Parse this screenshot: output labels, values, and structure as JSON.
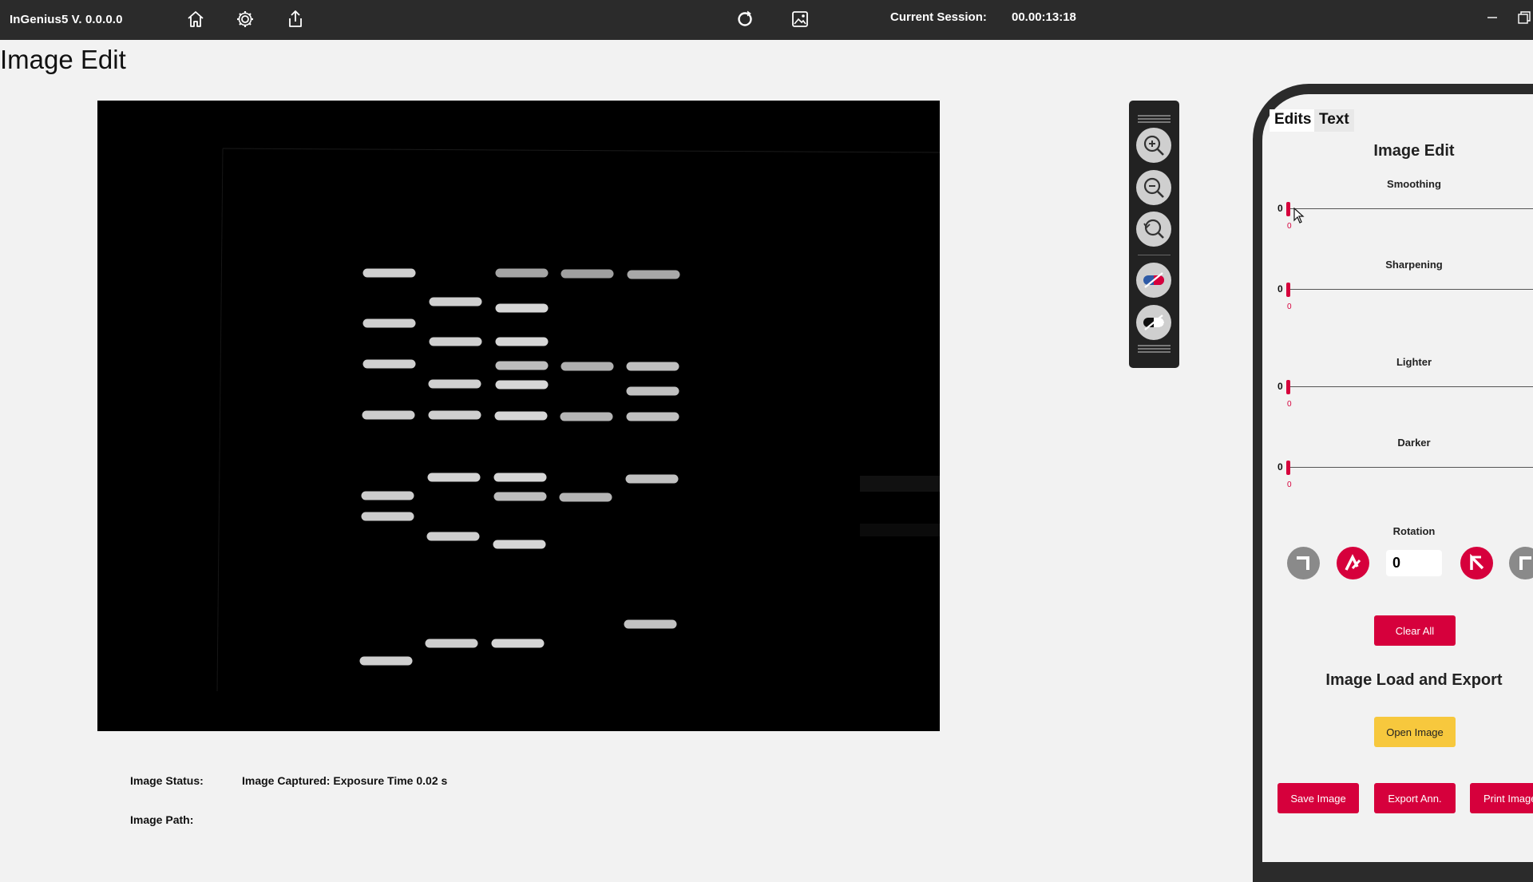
{
  "app": {
    "title": "InGenius5 V. 0.0.0.0"
  },
  "topbar": {
    "icons": [
      "home-icon",
      "gear-icon",
      "share-icon",
      "refresh-icon",
      "image-icon"
    ],
    "session_label": "Current Session:",
    "session_time": "00.00:13:18"
  },
  "page": {
    "title": "Image Edit"
  },
  "status": {
    "image_status_label": "Image Status:",
    "image_status_value": "Image Captured: Exposure Time  0.02 s",
    "image_path_label": "Image Path:"
  },
  "panel": {
    "tabs": [
      "Edits",
      "Text"
    ],
    "active_tab": "Edits",
    "heading": "Image Edit",
    "sliders": [
      {
        "label": "Smoothing",
        "min_label": "0",
        "value": 0,
        "value_text": "0"
      },
      {
        "label": "Sharpening",
        "min_label": "0",
        "value": 0,
        "value_text": "0"
      },
      {
        "label": "Lighter",
        "min_label": "0",
        "value": 0,
        "value_text": "0"
      },
      {
        "label": "Darker",
        "min_label": "0",
        "value": 0,
        "value_text": "0"
      }
    ],
    "rotation": {
      "label": "Rotation",
      "value": "0"
    },
    "clear_all": "Clear All",
    "load_export_heading": "Image Load and Export",
    "open_image": "Open Image",
    "save_image": "Save Image",
    "export_ann": "Export Ann.",
    "print_image": "Print Image"
  },
  "colors": {
    "accent": "#d6003c",
    "yellow": "#f7c83d",
    "topbar": "#2b2b2b"
  }
}
